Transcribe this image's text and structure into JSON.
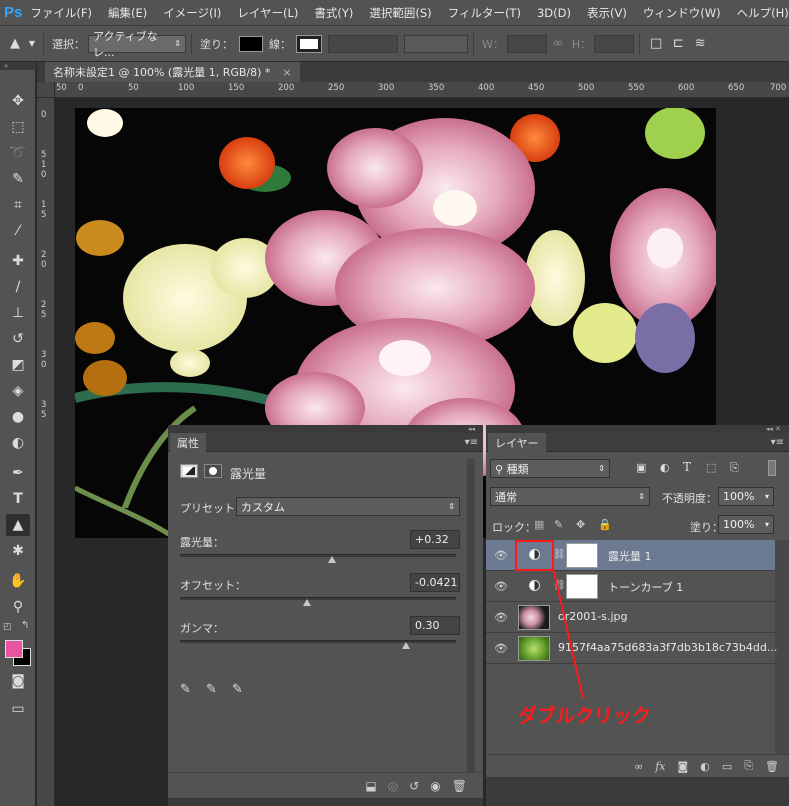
{
  "app": {
    "logo": "Ps"
  },
  "menubar": {
    "items": [
      "ファイル(F)",
      "編集(E)",
      "イメージ(I)",
      "レイヤー(L)",
      "書式(Y)",
      "選択範囲(S)",
      "フィルター(T)",
      "3D(D)",
      "表示(V)",
      "ウィンドウ(W)",
      "ヘルプ(H)"
    ]
  },
  "optionsbar": {
    "select_label": "選択：",
    "select_value": "アクティブなレ...",
    "fill_label": "塗り：",
    "stroke_label": "線：",
    "w_label": "W：",
    "h_label": "H："
  },
  "document": {
    "tab_title": "名称未設定1 @ 100% (露光量 1, RGB/8) *",
    "close": "×"
  },
  "ruler": {
    "h_labels": [
      "50",
      "0",
      "50",
      "100",
      "150",
      "200",
      "250",
      "300",
      "350",
      "400",
      "450",
      "500",
      "550",
      "600",
      "650",
      "700"
    ],
    "v_labels": [
      "0",
      "5",
      "1",
      "0",
      "1",
      "5",
      "2",
      "0",
      "2",
      "5",
      "3",
      "0",
      "3",
      "5"
    ]
  },
  "properties": {
    "tab": "属性",
    "title": "露光量",
    "preset_label": "プリセット：",
    "preset_value": "カスタム",
    "exposure_label": "露光量：",
    "exposure_value": "+0.32",
    "exposure_level": 0.55,
    "offset_label": "オフセット：",
    "offset_value": "-0.0421",
    "offset_level": 0.46,
    "gamma_label": "ガンマ：",
    "gamma_value": "0.30",
    "gamma_level": 0.82
  },
  "layers": {
    "tab": "レイヤー",
    "filter_value": "種類",
    "blend_mode": "通常",
    "opacity_label": "不透明度：",
    "opacity_value": "100%",
    "lock_label": "ロック：",
    "fill_label": "塗り：",
    "fill_value": "100%",
    "items": [
      {
        "name": "露光量 1"
      },
      {
        "name": "トーンカーブ 1"
      },
      {
        "name": "or2001-s.jpg"
      },
      {
        "name": "9157f4aa75d683a3f7db3b18c73b4dd..."
      }
    ]
  },
  "annotation": {
    "text": "ダブルクリック",
    "color": "#ff1a1a"
  },
  "colors": {
    "foreground": "#e8549f",
    "background": "#000000",
    "selected_layer": "#6b7a91"
  }
}
